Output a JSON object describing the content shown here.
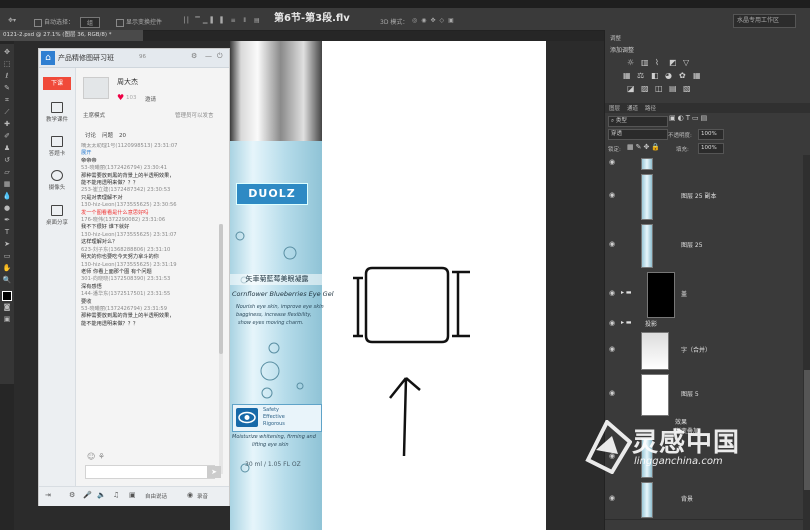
{
  "window": {
    "video_title": "第6节-第3段.flv",
    "doc_tab": "0121-2.psd @ 27.1% (图层 36, RGB/8) *"
  },
  "options": {
    "auto_select": "自动选择：",
    "group": "组",
    "show_transform": "显示变换控件",
    "mode_3d": "3D 模式：",
    "workspace": "水晶专用工作区"
  },
  "chat": {
    "title": "产品精修图研习班",
    "member_count": "96",
    "side": {
      "down": "下课",
      "courseware": "教学课件",
      "answer_card": "答题卡",
      "camera": "摄像头",
      "desktop_share": "桌面分享"
    },
    "host": {
      "name": "周大杰",
      "likes": "103",
      "invite": "邀请",
      "mode": "主席模式",
      "manager_only": "管理员可以发言"
    },
    "tabs": {
      "discussion": "讨论",
      "question": "问题",
      "question_count": "20"
    },
    "messages": [
      {
        "cls": "meta",
        "text": "喃太太助理1号(1120998513) 23:31:07"
      },
      {
        "cls": "blue",
        "text": "展开"
      },
      {
        "cls": "body",
        "text": "帝帝帝"
      },
      {
        "cls": "meta",
        "text": "53-晓曦丽(1372426794) 23:30:41"
      },
      {
        "cls": "body",
        "text": "那种需要放到黑的背景上的半透明效果，"
      },
      {
        "cls": "body",
        "text": "能不能用透明来做？？？"
      },
      {
        "cls": "meta",
        "text": "253-崔立建(1372487342) 23:30:53"
      },
      {
        "cls": "body",
        "text": "只是对表理解不对"
      },
      {
        "cls": "meta",
        "text": "130-hiz-Leon(1373555625) 23:30:56"
      },
      {
        "cls": "body",
        "text": " "
      },
      {
        "cls": "red",
        "text": "发一个图看看是什么意思好吗"
      },
      {
        "cls": "body",
        "text": " "
      },
      {
        "cls": "body",
        "text": " "
      },
      {
        "cls": "body",
        "text": " "
      },
      {
        "cls": "meta",
        "text": "176-晓伟(1372290082) 23:31:06"
      },
      {
        "cls": "body",
        "text": "我不下很好 谁下就好"
      },
      {
        "cls": "meta",
        "text": "130-hiz-Leon(1373555625) 23:31:07"
      },
      {
        "cls": "body",
        "text": "这样理解对么？"
      },
      {
        "cls": "meta",
        "text": "623-刘子东(1368288806) 23:31:10"
      },
      {
        "cls": "body",
        "text": "明天的你也要吃今天努力拿斗的你"
      },
      {
        "cls": "meta",
        "text": "130-hiz-Leon(1373555625) 23:31:19"
      },
      {
        "cls": "body",
        "text": "老师 你看上面那个图   有个问题"
      },
      {
        "cls": "meta",
        "text": "301-向晓晓(1372508390) 23:31:53"
      },
      {
        "cls": "body",
        "text": "深有感悟"
      },
      {
        "cls": "meta",
        "text": "144-潘华东(1372517501) 23:31:55"
      },
      {
        "cls": "body",
        "text": "要收"
      },
      {
        "cls": "meta",
        "text": "53-晓曦丽(1372426794) 23:31:59"
      },
      {
        "cls": "body",
        "text": "那种需要放到黑的背景上的半透明效果，"
      },
      {
        "cls": "body",
        "text": "能不能用透明来做？？？"
      }
    ],
    "footer": {
      "free_talk": "自由说话",
      "record": "录音"
    }
  },
  "product": {
    "brand": "DUOLZ",
    "name_cn": "矢車菊藍莓美眼凝露",
    "name_en": "Cornflower Blueberries Eye Gel",
    "desc": [
      "Nourish eye skin, improve eye skin",
      "bagginess, increase flexibility,",
      "show eyes moving charm."
    ],
    "safety": [
      "Safety",
      "Effective",
      "Rigorous"
    ],
    "tag": [
      "Moisturize whitening, firming and",
      "lifting eye skin"
    ],
    "volume": "30 ml / 1.05 FL OZ"
  },
  "panels": {
    "top_tab": "调整",
    "adjust_title": "添加调整",
    "layer_tabs": [
      "图层",
      "通道",
      "路径"
    ],
    "kind": "类型",
    "blend": "穿透",
    "opacity_label": "不透明度:",
    "opacity": "100%",
    "lock": "锁定:",
    "fill_label": "填充:",
    "fill": "100%",
    "layers": [
      {
        "name": "",
        "h": 16,
        "thumb": "bottle"
      },
      {
        "name": "图层 25 副本",
        "h": 50,
        "thumb": "bottle"
      },
      {
        "name": "图层 25",
        "h": 48,
        "thumb": "bottle"
      },
      {
        "name": "盖",
        "h": 50,
        "thumb": "black-folder"
      },
      {
        "name": "投影",
        "h": 10,
        "thumb": "folder"
      },
      {
        "name": "字（合并）",
        "h": 42,
        "thumb": "grad"
      },
      {
        "name": "图层 5",
        "h": 46,
        "thumb": "white"
      },
      {
        "name": "效果",
        "h": 9,
        "thumb": "none"
      },
      {
        "name": "渐变叠加",
        "h": 9,
        "thumb": "none"
      },
      {
        "name": "",
        "h": 44,
        "thumb": "bottle"
      },
      {
        "name": "背景",
        "h": 40,
        "thumb": "bottle"
      }
    ]
  },
  "watermark": {
    "cn": "灵感中国",
    "url": "lingganchina.com"
  }
}
